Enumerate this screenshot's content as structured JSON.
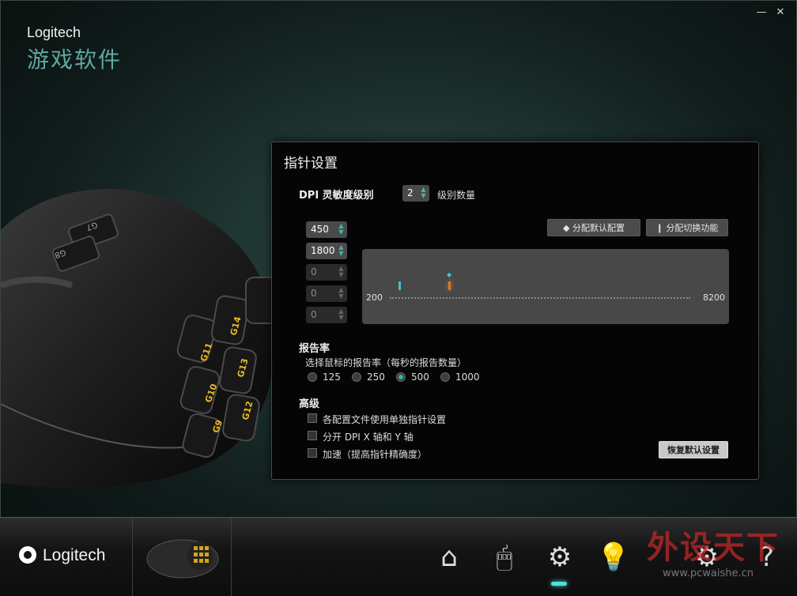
{
  "window": {
    "minimize_glyph": "—",
    "close_glyph": "✕"
  },
  "brand": {
    "name": "Logitech",
    "subtitle": "游戏软件"
  },
  "mouse_buttons": [
    "G7",
    "G8",
    "G14",
    "G13",
    "G12",
    "G11",
    "G10",
    "G9"
  ],
  "panel": {
    "title": "指针设置",
    "dpi_label": "DPI 灵敏度级别",
    "level_count": "2",
    "level_count_label": "级别数量",
    "dpi_levels": [
      "450",
      "1800",
      "0",
      "0",
      "0"
    ],
    "assign_default_button": "◆ 分配默认配置",
    "assign_shift_button": "❙ 分配切换功能",
    "slider_min": "200",
    "slider_max": "8200",
    "report_rate_label": "报告率",
    "report_rate_desc": "选择鼠标的报告率（每秒的报告数量）",
    "report_rates": [
      "125",
      "250",
      "500",
      "1000"
    ],
    "report_rate_selected": "500",
    "advanced_label": "高级",
    "advanced_options": [
      "各配置文件使用单独指针设置",
      "分开 DPI X 轴和 Y 轴",
      "加速（提高指针精确度）"
    ],
    "restore_defaults_button": "恢复默认设置"
  },
  "bottom": {
    "brand": "Logitech",
    "nav_icons": [
      "home-icon",
      "assign-icon",
      "pointer-settings-icon",
      "lighting-icon",
      "settings-gear-icon",
      "help-icon"
    ],
    "watermark": "外设天下",
    "watermark_url": "www.pcwaishe.cn"
  },
  "colors": {
    "accent": "#2fb3a4",
    "active_tick": "#e0762a"
  }
}
